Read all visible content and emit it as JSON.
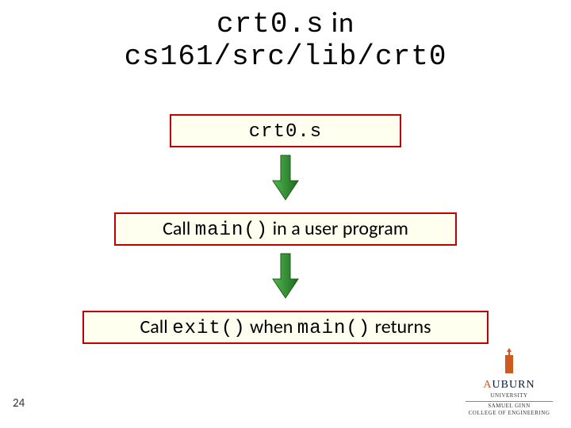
{
  "title": {
    "part1_code": "crt0.s",
    "part1_plain": " in",
    "line2_code": "cs161/src/lib/crt0"
  },
  "box1": {
    "code": "crt0.s"
  },
  "box2": {
    "pre": "Call ",
    "code": "main()",
    "post": " in a user program"
  },
  "box3": {
    "pre": "Call ",
    "code1": "exit()",
    "mid": " when ",
    "code2": "main()",
    "post": " returns"
  },
  "slide_number": "24",
  "logo": {
    "name_part1": "A",
    "name_part2": "UBURN",
    "sub1": "UNIVERSITY",
    "sub2": "SAMUEL GINN",
    "sub3": "COLLEGE OF ENGINEERING"
  },
  "colors": {
    "box_border": "#c00000",
    "box_fill": "#fffff0",
    "arrow_fill": "#2e8b2e",
    "arrow_stroke": "#1e5a1e"
  }
}
